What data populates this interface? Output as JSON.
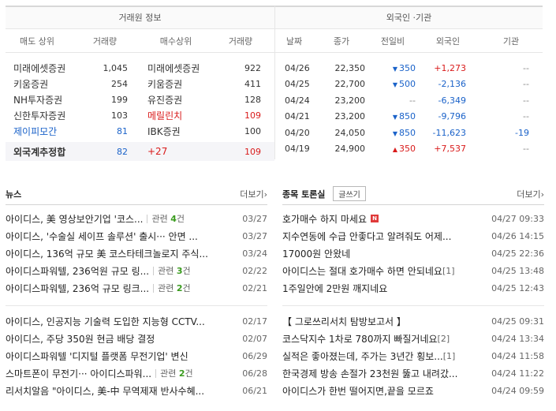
{
  "broker_info": {
    "title": "거래원 정보",
    "headers": [
      "매도 상위",
      "거래량",
      "매수상위",
      "거래량"
    ],
    "rows": [
      {
        "sell_name": "미래에셋증권",
        "sell_vol": "1,045",
        "buy_name": "미래에셋증권",
        "buy_vol": "922"
      },
      {
        "sell_name": "키움증권",
        "sell_vol": "254",
        "buy_name": "키움증권",
        "buy_vol": "411"
      },
      {
        "sell_name": "NH투자증권",
        "sell_vol": "199",
        "buy_name": "유진증권",
        "buy_vol": "128"
      },
      {
        "sell_name": "신한투자증권",
        "sell_vol": "103",
        "buy_name": "메릴린치",
        "buy_vol": "109"
      },
      {
        "sell_name": "제이피모간",
        "sell_vol": "81",
        "buy_name": "IBK증권",
        "buy_vol": "100"
      }
    ],
    "foreign_total": {
      "label": "외국계추정합",
      "sell_vol": "82",
      "diff": "+27",
      "buy_vol": "109"
    }
  },
  "foreign_inst": {
    "title": "외국인 ·기관",
    "headers": [
      "날짜",
      "종가",
      "전일비",
      "외국인",
      "기관"
    ],
    "rows": [
      {
        "date": "04/26",
        "close": "22,350",
        "dir": "down",
        "diff": "350",
        "foreign": "+1,273",
        "inst": "--"
      },
      {
        "date": "04/25",
        "close": "22,700",
        "dir": "down",
        "diff": "500",
        "foreign": "-2,136",
        "inst": "--"
      },
      {
        "date": "04/24",
        "close": "23,200",
        "dir": "flat",
        "diff": "--",
        "foreign": "-6,349",
        "inst": "--"
      },
      {
        "date": "04/21",
        "close": "23,200",
        "dir": "down",
        "diff": "850",
        "foreign": "-9,796",
        "inst": "--"
      },
      {
        "date": "04/20",
        "close": "24,050",
        "dir": "down",
        "diff": "850",
        "foreign": "-11,623",
        "inst": "-19"
      },
      {
        "date": "04/19",
        "close": "24,900",
        "dir": "up",
        "diff": "350",
        "foreign": "+7,537",
        "inst": "--"
      }
    ]
  },
  "news": {
    "title": "뉴스",
    "more": "더보기",
    "items": [
      {
        "text": "아이디스, 美 영상보안기업 '코스...",
        "related": "4",
        "date": "03/27"
      },
      {
        "text": "아이디스, '수술실 세이프 솔루션' 출시··· 안면 ...",
        "related": "",
        "date": "03/27"
      },
      {
        "text": "아이디스, 136억 규모 美 코스타테크놀로지 주식...",
        "related": "",
        "date": "03/24"
      },
      {
        "text": "아이디스파워텔, 236억원 규모 링...",
        "related": "3",
        "date": "02/22"
      },
      {
        "text": "아이디스파워텔, 236억 규모 링크...",
        "related": "2",
        "date": "02/21"
      }
    ],
    "items2": [
      {
        "text": "아이디스, 인공지능 기술력 도입한 지능형 CCTV...",
        "related": "",
        "date": "02/17"
      },
      {
        "text": "아이디스, 주당 350원 현금 배당 결정",
        "related": "",
        "date": "02/07"
      },
      {
        "text": "아이디스파워텔 '디지털 플랫폼 무전기업' 변신",
        "related": "",
        "date": "06/29"
      },
      {
        "text": "스마트폰이 무전기··· 아이디스파워...",
        "related": "2",
        "date": "06/28"
      },
      {
        "text": "리서치알음 \"아이디스, 美-中 무역제재 반사수혜...",
        "related": "",
        "date": "06/21"
      }
    ],
    "related_label": "관련",
    "related_unit": "건"
  },
  "board": {
    "title": "종목 토론실",
    "write_label": "글쓰기",
    "more": "더보기",
    "items": [
      {
        "text": "호가매수 하지 마세요",
        "comments": "",
        "is_new": true,
        "date": "04/27 09:33"
      },
      {
        "text": "지수연동에 수급 안좋다고 알려줘도 어제...",
        "comments": "",
        "is_new": false,
        "date": "04/26 14:15"
      },
      {
        "text": "17000원 안왔네",
        "comments": "",
        "is_new": false,
        "date": "04/25 22:36"
      },
      {
        "text": "아이디스는 절대 호가매수 하면 안되네요",
        "comments": "[1]",
        "is_new": false,
        "date": "04/25 13:48"
      },
      {
        "text": "1주일안에 2만원 깨지네요",
        "comments": "",
        "is_new": false,
        "date": "04/25 12:43"
      }
    ],
    "items2": [
      {
        "text": "【 그로쓰리서치 탐방보고서 】",
        "comments": "",
        "is_new": false,
        "date": "04/25 09:31"
      },
      {
        "text": "코스닥지수 1차로 780까지 빠질거네요",
        "comments": "[2]",
        "is_new": false,
        "date": "04/24 13:34"
      },
      {
        "text": "실적은 좋아졌는데, 주가는 3년간 횡보...",
        "comments": "[1]",
        "is_new": false,
        "date": "04/24 11:58"
      },
      {
        "text": "한국경제 방송 손절가 23천원 뚫고 내려갔...",
        "comments": "",
        "is_new": false,
        "date": "04/24 11:22"
      },
      {
        "text": "아이디스가 한번 떨어지면,끝을 모르죠",
        "comments": "",
        "is_new": false,
        "date": "04/24 09:59"
      }
    ],
    "new_badge": "N"
  },
  "colors": {
    "up": "#d91b1b",
    "down": "#1a62c9",
    "related_count": "#3a9b1e"
  },
  "icons": {
    "down": "triangle-down-icon",
    "up": "triangle-up-icon",
    "more": "chevron-right-icon",
    "new": "new-badge-icon"
  }
}
